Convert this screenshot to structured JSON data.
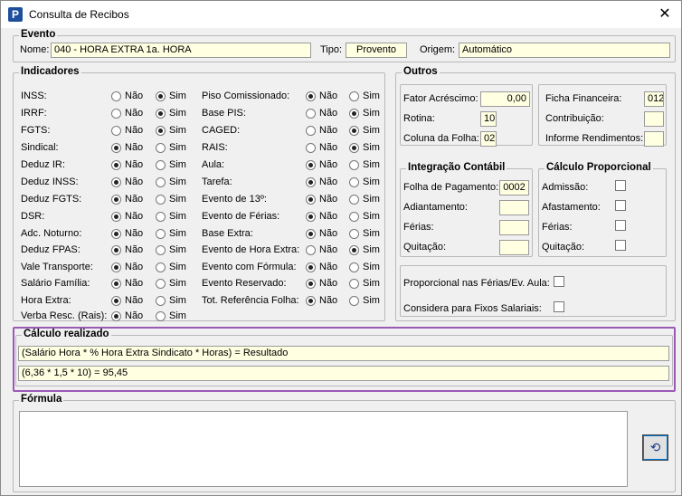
{
  "window": {
    "title": "Consulta de Recibos",
    "icon": "app-p-icon",
    "close_glyph": "✕"
  },
  "evento": {
    "legend": "Evento",
    "nome_label": "Nome:",
    "nome": "040 - HORA EXTRA 1a. HORA",
    "tipo_label": "Tipo:",
    "tipo": "Provento",
    "origem_label": "Origem:",
    "origem": "Automático"
  },
  "indicadores": {
    "legend": "Indicadores",
    "nao": "Não",
    "sim": "Sim",
    "left": [
      {
        "label": "INSS:",
        "sim": true
      },
      {
        "label": "IRRF:",
        "sim": true
      },
      {
        "label": "FGTS:",
        "sim": true
      },
      {
        "label": "Sindical:",
        "sim": false
      },
      {
        "label": "Deduz IR:",
        "sim": false
      },
      {
        "label": "Deduz INSS:",
        "sim": false
      },
      {
        "label": "Deduz FGTS:",
        "sim": false
      },
      {
        "label": "DSR:",
        "sim": false
      },
      {
        "label": "Adc. Noturno:",
        "sim": false
      },
      {
        "label": "Deduz FPAS:",
        "sim": false
      },
      {
        "label": "Vale Transporte:",
        "sim": false
      },
      {
        "label": "Salário Família:",
        "sim": false
      },
      {
        "label": "Hora Extra:",
        "sim": false
      },
      {
        "label": "Verba Resc. (Rais):",
        "sim": false
      }
    ],
    "right": [
      {
        "label": "Piso Comissionado:",
        "sim": false
      },
      {
        "label": "Base PIS:",
        "sim": true
      },
      {
        "label": "CAGED:",
        "sim": true
      },
      {
        "label": "RAIS:",
        "sim": true
      },
      {
        "label": "Aula:",
        "sim": false
      },
      {
        "label": "Tarefa:",
        "sim": false
      },
      {
        "label": "Evento de 13º:",
        "sim": false
      },
      {
        "label": "Evento de Férias:",
        "sim": false
      },
      {
        "label": "Base Extra:",
        "sim": false
      },
      {
        "label": "Evento de Hora Extra:",
        "sim": true
      },
      {
        "label": "Evento com Fórmula:",
        "sim": false
      },
      {
        "label": "Evento Reservado:",
        "sim": false
      },
      {
        "label": "Tot. Referência Folha:",
        "sim": false
      }
    ]
  },
  "outros": {
    "legend": "Outros",
    "fator_label": "Fator Acréscimo:",
    "fator": "0,00",
    "rotina_label": "Rotina:",
    "rotina": "10",
    "coluna_label": "Coluna da Folha:",
    "coluna": "02",
    "ficha_label": "Ficha Financeira:",
    "ficha": "012",
    "contrib_label": "Contribuição:",
    "contrib": "",
    "informe_label": "Informe Rendimentos:",
    "informe": ""
  },
  "integracao": {
    "legend": "Integração Contábil",
    "folha_label": "Folha de Pagamento:",
    "folha": "0002",
    "adiant_label": "Adiantamento:",
    "adiant": "",
    "ferias_label": "Férias:",
    "ferias": "",
    "quit_label": "Quitação:",
    "quit": ""
  },
  "proporcional": {
    "legend": "Cálculo Proporcional",
    "admissao": "Admissão:",
    "afastamento": "Afastamento:",
    "ferias": "Férias:",
    "quitacao": "Quitação:"
  },
  "flags": {
    "prop_ferias": "Proporcional nas Férias/Ev. Aula:",
    "fixos": "Considera para Fixos Salariais:"
  },
  "calculo": {
    "legend": "Cálculo realizado",
    "formula": "(Salário Hora * % Hora Extra Sindicato * Horas) = Resultado",
    "resultado": "(6,36 * 1,5 * 10) = 95,45"
  },
  "formula": {
    "legend": "Fórmula",
    "text": "",
    "undo_icon": "undo-icon"
  },
  "colors": {
    "field_bg": "#ffffe1",
    "highlight": "#9b59b6"
  }
}
